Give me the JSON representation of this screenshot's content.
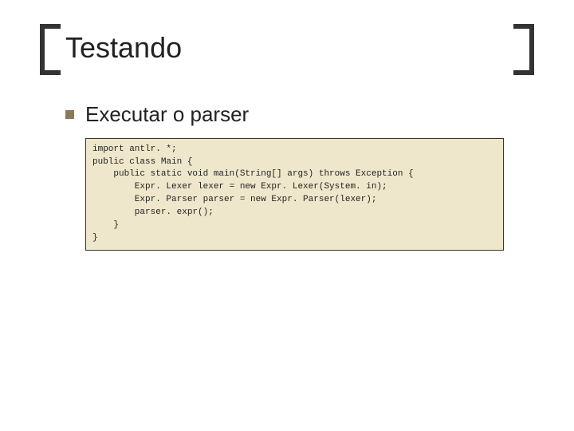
{
  "slide": {
    "title": "Testando",
    "bullet1": "Executar o parser",
    "code": "import antlr. *;\npublic class Main {\n    public static void main(String[] args) throws Exception {\n        Expr. Lexer lexer = new Expr. Lexer(System. in);\n        Expr. Parser parser = new Expr. Parser(lexer);\n        parser. expr();\n    }\n}"
  }
}
